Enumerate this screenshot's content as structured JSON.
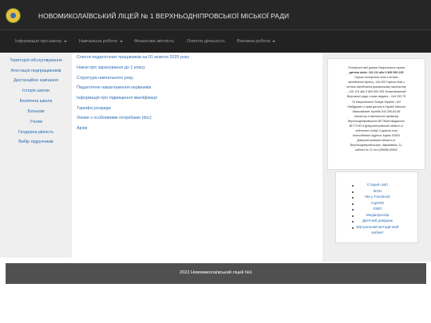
{
  "site": {
    "title": "НОВОМИКОЛАЇВСЬКИЙ ЛІЦЕЙ № 1 ВЕРХНЬОДНІПРОВСЬКОЇ МІСЬКОЇ РАДИ",
    "logo_icon": "school-emblem-icon"
  },
  "nav": {
    "items": [
      {
        "label": "Інформація про школу",
        "dropdown": true
      },
      {
        "label": "Навчальна робота",
        "dropdown": true
      },
      {
        "label": "Фінансова звітність",
        "dropdown": false
      },
      {
        "label": "Освітня діяльність",
        "dropdown": false
      },
      {
        "label": "Виховна робота",
        "dropdown": true
      }
    ]
  },
  "sidebar": {
    "items": [
      {
        "label": "Територія обслуговування"
      },
      {
        "label": "Атестація педпрацівників"
      },
      {
        "label": "Дистанційне навчання"
      },
      {
        "label": "Історія школи"
      },
      {
        "label": "Безпечна школа"
      },
      {
        "label": "Батькам"
      },
      {
        "label": "Учням"
      },
      {
        "label": "Гендерна рівність"
      },
      {
        "label": "Вибір підручників"
      }
    ]
  },
  "main": {
    "links": [
      {
        "label": "Список педагогічних працівників на 01 жовтня 2025 року"
      },
      {
        "label": "Накзи про зарахування до 1 класу"
      },
      {
        "label": "Структура навчального року"
      },
      {
        "label": "Педагогічне навантаження керівників"
      },
      {
        "label": "Інформація про підвищення кваліфікації"
      },
      {
        "label": "Тарифні розряди"
      },
      {
        "label": "Умови з особливими потребами (doc)"
      },
      {
        "label": "Архів"
      }
    ]
  },
  "info": {
    "lines": [
      {
        "text": "Телефонні лінії довіри Національна гаряча"
      },
      {
        "text": "дитяча лінія: 116 111 або 0 800 500 225"
      },
      {
        "text": "Гаряча телефонна лінія з питань"
      },
      {
        "text": "запобігання булінгу -116 000 Гаряча лінія з"
      },
      {
        "text": "питань запобігання домашньому насильству"
      },
      {
        "text": "– 116 123 або 0 800 500 335 Уповноважений"
      },
      {
        "text": "Верховної ради з прав людини – 044 253 75"
      },
      {
        "text": "76 Національна Поліція України -102"
      },
      {
        "text": "Омбудсмен з прав дитини в Україні Микола"
      },
      {
        "text": "Миколайович Кулеба 044 255-64-56"
      },
      {
        "text": "Інспектор з ювенальної превенції"
      },
      {
        "text": "Верхньодніпровського ВП Жовтоводського"
      },
      {
        "text": "ВП ГУНП в Дніпропетровській області ст"
      },
      {
        "text": "лейтенант поліції Саранча Ілля"
      },
      {
        "text": "Анатолійович Адреса: індекс 51600"
      },
      {
        "text": "Дніпропетровська область м."
      },
      {
        "text": "Верхньодніпровськ вул. Аврамкина, 21,"
      },
      {
        "text": "кабінет № 21 тел.(05658) 60602"
      }
    ]
  },
  "useful_links": {
    "items": [
      {
        "label": "Старий сайт"
      },
      {
        "label": "МОН"
      },
      {
        "label": "Ми у Facebook"
      },
      {
        "label": "УЦОЯО"
      },
      {
        "label": "ІОВО"
      },
      {
        "label": "Медіапросвір"
      },
      {
        "label": "Дитячий довідник"
      },
      {
        "label": "Віртуальний методичний"
      },
      {
        "label": "кабінет"
      }
    ]
  },
  "footer": {
    "text": "2022 Новомиколаївський ліцей №1"
  },
  "colors": {
    "header_bg": "#262626",
    "navbar_bg": "#222222",
    "link": "#2f6fb5",
    "footer_bg": "#505050"
  }
}
